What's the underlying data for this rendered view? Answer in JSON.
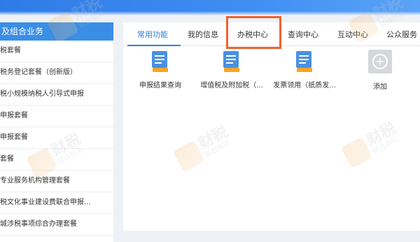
{
  "sidebar": {
    "header": "及组合业务",
    "items": [
      {
        "label": "税套餐"
      },
      {
        "label": "税务登记套餐（创新版）"
      },
      {
        "label": "税小规模纳税人引导式申报"
      },
      {
        "label": "申报套餐"
      },
      {
        "label": "申报套餐"
      },
      {
        "label": "套餐"
      },
      {
        "label": "专业服务机构管理套餐"
      },
      {
        "label": "税文化事业建设费联合申报..."
      },
      {
        "label": "城涉税事项综合办理套餐"
      }
    ]
  },
  "tabs": [
    {
      "label": "常用功能"
    },
    {
      "label": "我的信息"
    },
    {
      "label": "办税中心"
    },
    {
      "label": "查询中心"
    },
    {
      "label": "互动中心"
    },
    {
      "label": "公众服务"
    }
  ],
  "functions": [
    {
      "label": "申报结果查询",
      "icon": "document-icon"
    },
    {
      "label": "增值税及附加税（...",
      "icon": "document-icon"
    },
    {
      "label": "发票领用（纸质发...",
      "icon": "document-icon"
    },
    {
      "label": "添加",
      "icon": "plus-icon"
    }
  ],
  "watermark": {
    "big": "财税",
    "small": "联合邦拓"
  },
  "colors": {
    "accent": "#2e7fdb",
    "sidebar_header": "#3a8ee6",
    "highlight": "#f0622a",
    "icon_orange": "#f5a623",
    "icon_blue": "#4a90e2"
  }
}
